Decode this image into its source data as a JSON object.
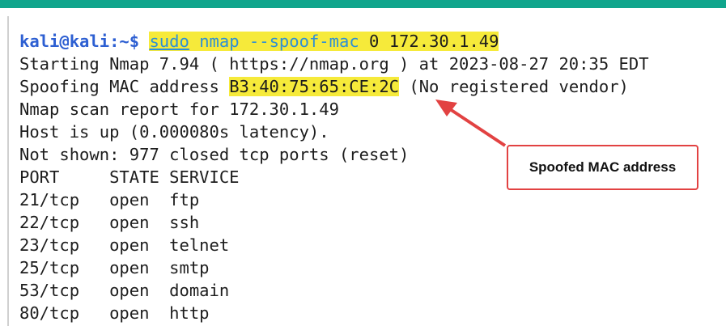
{
  "terminal": {
    "prompt_user": "kali@kali",
    "prompt_sep": ":~$",
    "command": {
      "sudo": "sudo",
      "nmap": "nmap",
      "flag": "--spoof-mac",
      "arg": "0",
      "target": "172.30.1.49"
    },
    "lines": [
      "Starting Nmap 7.94 ( https://nmap.org ) at 2023-08-27 20:35 EDT",
      "Nmap scan report for 172.30.1.49",
      "Host is up (0.000080s latency).",
      "Not shown: 977 closed tcp ports (reset)",
      "PORT     STATE SERVICE"
    ],
    "spoof_line": {
      "prefix": "Spoofing MAC address ",
      "mac": "B3:40:75:65:CE:2C",
      "suffix": " (No registered vendor)"
    },
    "ports": [
      {
        "port": "21/tcp",
        "state": "open",
        "service": "ftp"
      },
      {
        "port": "22/tcp",
        "state": "open",
        "service": "ssh"
      },
      {
        "port": "23/tcp",
        "state": "open",
        "service": "telnet"
      },
      {
        "port": "25/tcp",
        "state": "open",
        "service": "smtp"
      },
      {
        "port": "53/tcp",
        "state": "open",
        "service": "domain"
      },
      {
        "port": "80/tcp",
        "state": "open",
        "service": "http"
      }
    ]
  },
  "annotation": {
    "label": "Spoofed MAC address",
    "border_color": "#e24242",
    "arrow_color": "#e24242"
  },
  "colors": {
    "header_bar": "#10a58c",
    "highlight": "#f6ea3a",
    "prompt": "#2d5fd2",
    "command": "#2d8fd6"
  }
}
